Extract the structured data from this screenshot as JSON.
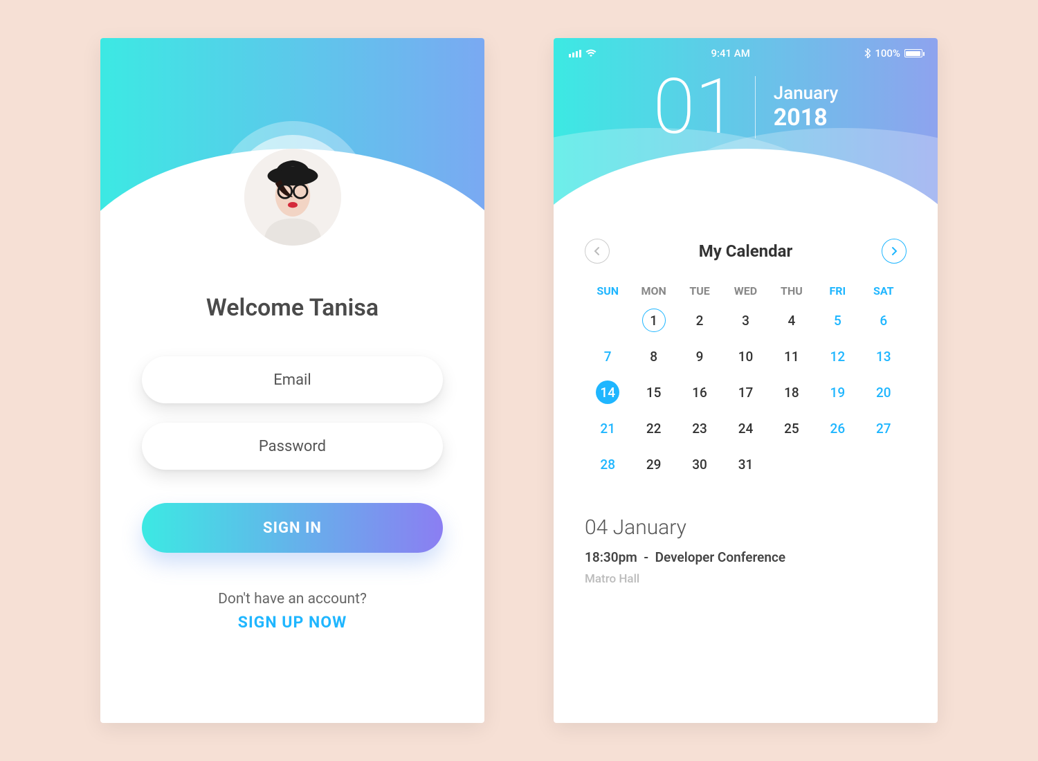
{
  "login": {
    "welcome": "Welcome Tanisa",
    "email_placeholder": "Email",
    "password_placeholder": "Password",
    "signin": "SIGN IN",
    "no_account": "Don't have an account?",
    "signup": "SIGN UP NOW"
  },
  "calendar": {
    "status": {
      "time": "9:41 AM",
      "battery": "100%"
    },
    "header": {
      "day": "01",
      "month": "January",
      "year": "2018"
    },
    "title": "My Calendar",
    "weekdays": [
      "SUN",
      "MON",
      "TUE",
      "WED",
      "THU",
      "FRI",
      "SAT"
    ],
    "days": [
      {
        "n": "",
        "wknd": true
      },
      {
        "n": "1",
        "circled": true
      },
      {
        "n": "2"
      },
      {
        "n": "3"
      },
      {
        "n": "4"
      },
      {
        "n": "5",
        "wknd": true
      },
      {
        "n": "6",
        "wknd": true
      },
      {
        "n": "7",
        "wknd": true
      },
      {
        "n": "8"
      },
      {
        "n": "9"
      },
      {
        "n": "10"
      },
      {
        "n": "11"
      },
      {
        "n": "12",
        "wknd": true
      },
      {
        "n": "13",
        "wknd": true
      },
      {
        "n": "14",
        "wknd": true,
        "selected": true
      },
      {
        "n": "15"
      },
      {
        "n": "16"
      },
      {
        "n": "17"
      },
      {
        "n": "18"
      },
      {
        "n": "19",
        "wknd": true
      },
      {
        "n": "20",
        "wknd": true
      },
      {
        "n": "21",
        "wknd": true
      },
      {
        "n": "22"
      },
      {
        "n": "23"
      },
      {
        "n": "24"
      },
      {
        "n": "25"
      },
      {
        "n": "26",
        "wknd": true
      },
      {
        "n": "27",
        "wknd": true
      },
      {
        "n": "28",
        "wknd": true
      },
      {
        "n": "29"
      },
      {
        "n": "30"
      },
      {
        "n": "31"
      },
      {
        "n": ""
      },
      {
        "n": ""
      },
      {
        "n": ""
      }
    ],
    "event": {
      "date": "04 January",
      "time": "18:30pm",
      "separator": "-",
      "name": "Developer Conference",
      "location": "Matro Hall"
    }
  }
}
